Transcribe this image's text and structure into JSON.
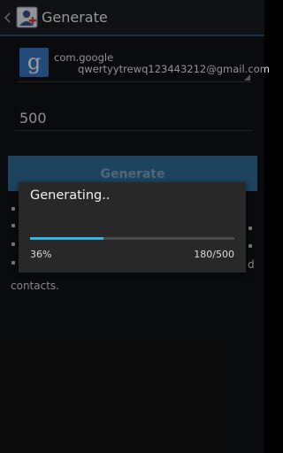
{
  "action_bar": {
    "title": "Generate"
  },
  "account": {
    "type": "com.google",
    "name": "qwertyytrewq123443212@gmail.com"
  },
  "count_field": {
    "value": "500"
  },
  "generate_button": {
    "label": "Generate"
  },
  "background_text": {
    "fragment_right": "d",
    "fragment_last": "contacts."
  },
  "progress_dialog": {
    "title": "Generating..",
    "progress_fraction": 0.36,
    "percent_label": "36%",
    "count_label": "180/500"
  },
  "colors": {
    "accent": "#33b5e5",
    "button": "#2f6d98",
    "background": "#111214"
  },
  "icons": {
    "back": "chevron-left-icon",
    "app": "contact-add-icon",
    "account": "google-icon",
    "spinner": "spinner-caret-icon"
  }
}
